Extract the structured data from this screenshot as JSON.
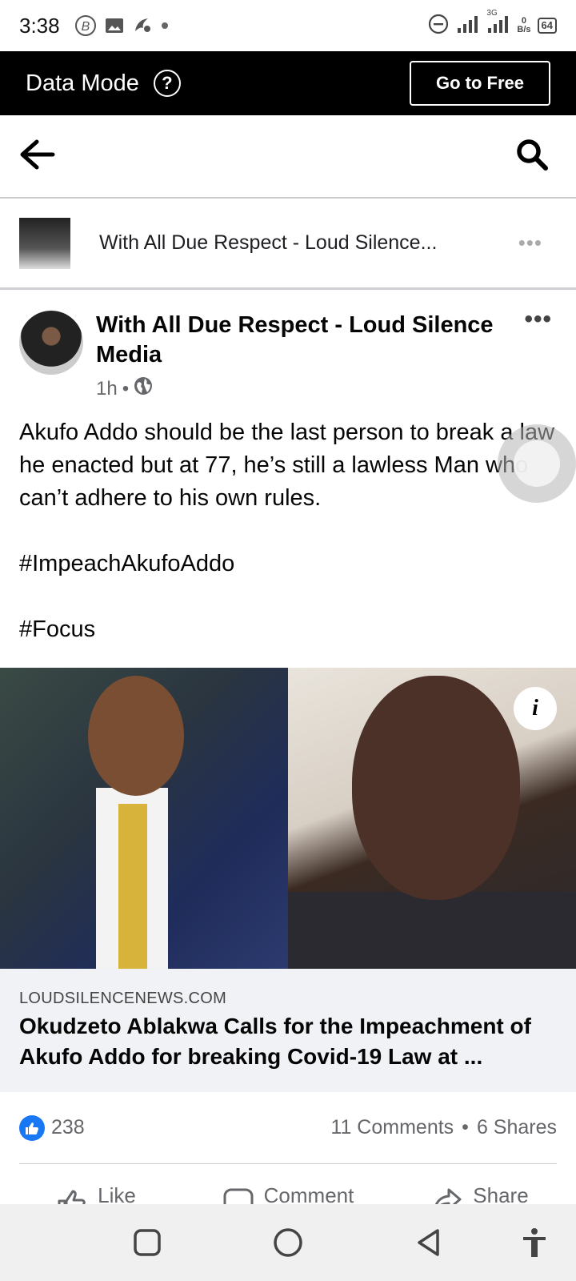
{
  "status_bar": {
    "time": "3:38",
    "network_label": "3G",
    "speed_value": "0",
    "speed_unit": "B/s",
    "battery": "64"
  },
  "data_mode_bar": {
    "title": "Data Mode",
    "go_free_label": "Go to Free"
  },
  "page_row": {
    "page_name": "With All Due Respect - Loud Silence..."
  },
  "post": {
    "author": "With All Due Respect - Loud Silence Media",
    "time": "1h",
    "separator": "•",
    "paragraphs": [
      "Akufo Addo should be the last person to break a law he enacted but at 77, he’s still a lawless Man who can’t adhere to his own rules.",
      "#ImpeachAkufoAddo",
      "#Focus"
    ]
  },
  "link_preview": {
    "domain": "LOUDSILENCENEWS.COM",
    "title": "Okudzeto Ablakwa Calls for the Impeachment of Akufo Addo for breaking Covid-19 Law at ..."
  },
  "reactions": {
    "like_count": "238",
    "comments": "11 Comments",
    "dot": "•",
    "shares": "6 Shares"
  },
  "actions": {
    "like": "Like",
    "comment": "Comment",
    "share": "Share"
  },
  "colors": {
    "facebook_blue": "#1877f2",
    "data_bar_bg": "#000000",
    "caption_bg": "#f0f2f5"
  }
}
